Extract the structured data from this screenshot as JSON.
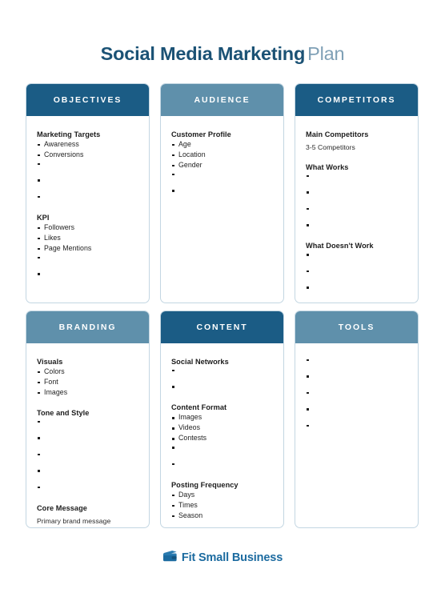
{
  "title": {
    "strong": "Social Media Marketing",
    "light": "Plan"
  },
  "colors": {
    "header_dark": "#1b5c85",
    "header_light": "#5f90ab",
    "title_strong": "#1b5275",
    "title_light": "#7fa0b6",
    "card_border": "#c3d6e2",
    "logo": "#1c6ba0"
  },
  "cards": [
    {
      "header": "OBJECTIVES",
      "header_style": "dark",
      "sections": [
        {
          "title": "Marketing Targets",
          "items": [
            "Awareness",
            "Conversions",
            "",
            "",
            ""
          ]
        },
        {
          "title": "KPI",
          "items": [
            "Followers",
            "Likes",
            "Page Mentions",
            "",
            ""
          ]
        }
      ]
    },
    {
      "header": "AUDIENCE",
      "header_style": "light",
      "sections": [
        {
          "title": "Customer Profile",
          "items": [
            "Age",
            "Location",
            "Gender",
            "",
            ""
          ]
        }
      ]
    },
    {
      "header": "COMPETITORS",
      "header_style": "dark",
      "sections": [
        {
          "title": "Main Competitors",
          "note": "3-5 Competitors",
          "items": []
        },
        {
          "title": "What Works",
          "items": [
            "",
            "",
            "",
            ""
          ]
        },
        {
          "title": "What Doesn't Work",
          "items": [
            "",
            "",
            ""
          ]
        }
      ]
    },
    {
      "header": "BRANDING",
      "header_style": "light",
      "sections": [
        {
          "title": "Visuals",
          "items": [
            "Colors",
            "Font",
            "Images"
          ]
        },
        {
          "title": "Tone and Style",
          "items": [
            "",
            "",
            "",
            "",
            ""
          ]
        },
        {
          "title": "Core Message",
          "note": "Primary brand message",
          "items": []
        }
      ]
    },
    {
      "header": "CONTENT",
      "header_style": "dark",
      "sections": [
        {
          "title": "Social Networks",
          "items": [
            "",
            ""
          ]
        },
        {
          "title": "Content Format",
          "items": [
            "Images",
            "Videos",
            "Contests",
            "",
            ""
          ]
        },
        {
          "title": "Posting Frequency",
          "items": [
            "Days",
            "Times",
            "Season"
          ]
        }
      ]
    },
    {
      "header": "TOOLS",
      "header_style": "light",
      "sections": [
        {
          "title": "",
          "items": [
            "",
            "",
            "",
            "",
            ""
          ]
        }
      ]
    }
  ],
  "footer": {
    "logo_text": "Fit Small Business",
    "logo_icon": "wallet-icon"
  }
}
